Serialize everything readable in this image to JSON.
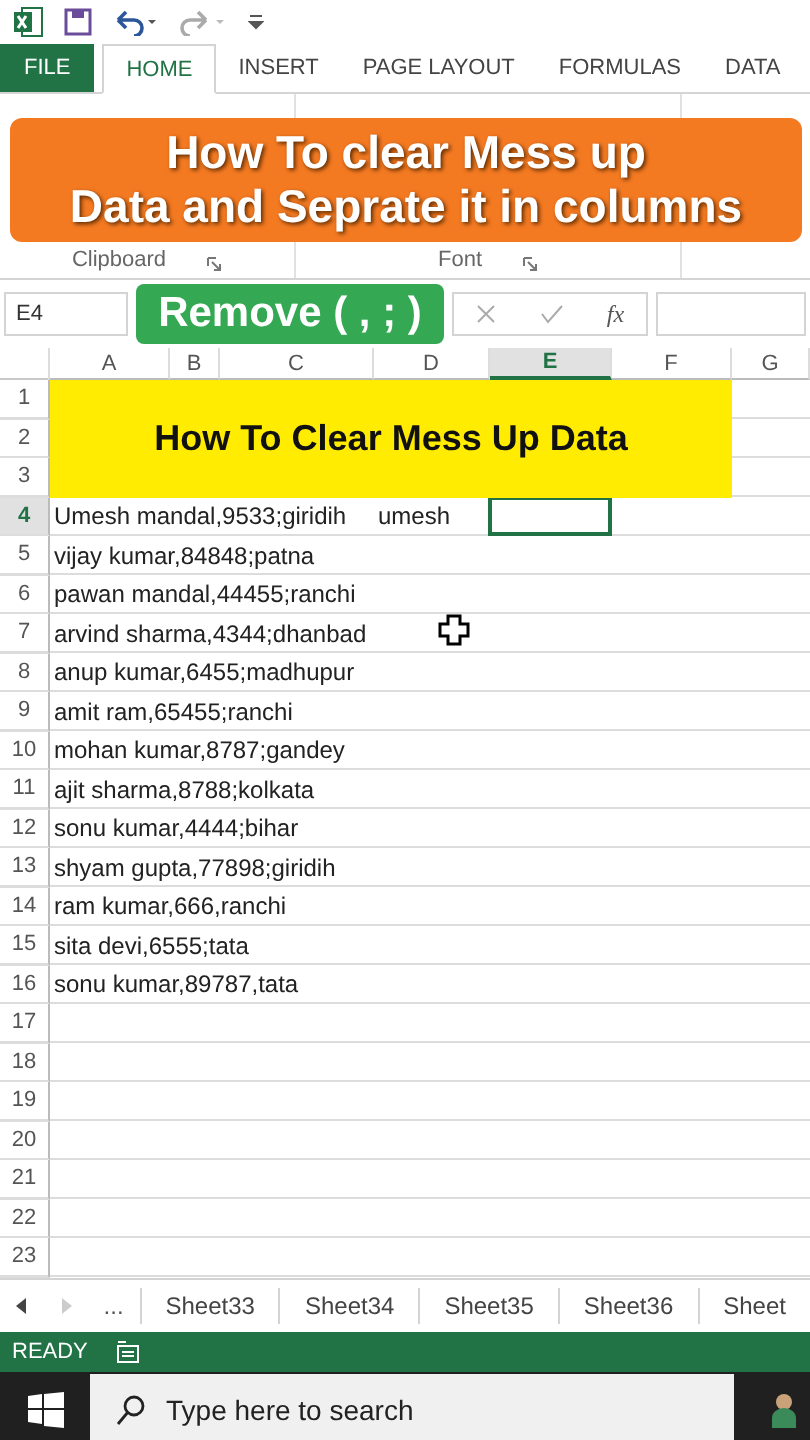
{
  "ribbon_tabs": [
    {
      "label": "FILE",
      "kind": "file",
      "selected": false
    },
    {
      "label": "HOME",
      "kind": "tab",
      "selected": true
    },
    {
      "label": "INSERT",
      "kind": "tab",
      "selected": false
    },
    {
      "label": "PAGE LAYOUT",
      "kind": "tab",
      "selected": false
    },
    {
      "label": "FORMULAS",
      "kind": "tab",
      "selected": false
    },
    {
      "label": "DATA",
      "kind": "tab",
      "selected": false
    }
  ],
  "ribbon_groups": [
    "Clipboard",
    "Font"
  ],
  "banner": {
    "lines": [
      "How To clear Mess up",
      "Data and Seprate it in columns"
    ]
  },
  "formula_bar": {
    "name_box": "E4",
    "overlay": "Remove ( , ; )",
    "fx": "fx"
  },
  "columns": [
    {
      "label": "A",
      "selected": false
    },
    {
      "label": "B",
      "selected": false
    },
    {
      "label": "C",
      "selected": false
    },
    {
      "label": "D",
      "selected": false
    },
    {
      "label": "E",
      "selected": true
    },
    {
      "label": "F",
      "selected": false
    },
    {
      "label": "G",
      "selected": false
    }
  ],
  "title_cell": {
    "text": "How To Clear Mess Up Data"
  },
  "rows": [
    {
      "number": "1",
      "selected": false
    },
    {
      "number": "2",
      "selected": false
    },
    {
      "number": "3",
      "selected": false
    },
    {
      "number": "4",
      "selected": true,
      "cells": {
        "A": "Umesh mandal,9533;giridih",
        "D": "umesh"
      }
    },
    {
      "number": "5",
      "selected": false,
      "cells": {
        "A": "vijay kumar,84848;patna"
      }
    },
    {
      "number": "6",
      "selected": false,
      "cells": {
        "A": "pawan mandal,44455;ranchi"
      }
    },
    {
      "number": "7",
      "selected": false,
      "cells": {
        "A": "arvind sharma,4344;dhanbad"
      }
    },
    {
      "number": "8",
      "selected": false,
      "cells": {
        "A": "anup kumar,6455;madhupur"
      }
    },
    {
      "number": "9",
      "selected": false,
      "cells": {
        "A": "amit ram,65455;ranchi"
      }
    },
    {
      "number": "10",
      "selected": false,
      "cells": {
        "A": "mohan kumar,8787;gandey"
      }
    },
    {
      "number": "11",
      "selected": false,
      "cells": {
        "A": "ajit sharma,8788;kolkata"
      }
    },
    {
      "number": "12",
      "selected": false,
      "cells": {
        "A": "sonu kumar,4444;bihar"
      }
    },
    {
      "number": "13",
      "selected": false,
      "cells": {
        "A": "shyam gupta,77898;giridih"
      }
    },
    {
      "number": "14",
      "selected": false,
      "cells": {
        "A": "ram kumar,666,ranchi"
      }
    },
    {
      "number": "15",
      "selected": false,
      "cells": {
        "A": "sita devi,6555;tata"
      }
    },
    {
      "number": "16",
      "selected": false,
      "cells": {
        "A": "sonu kumar,89787,tata"
      }
    },
    {
      "number": "17",
      "selected": false
    },
    {
      "number": "18",
      "selected": false
    },
    {
      "number": "19",
      "selected": false
    },
    {
      "number": "20",
      "selected": false
    },
    {
      "number": "21",
      "selected": false
    },
    {
      "number": "22",
      "selected": false
    },
    {
      "number": "23",
      "selected": false
    }
  ],
  "sheet_tabs": {
    "more": "...",
    "sheets": [
      "Sheet33",
      "Sheet34",
      "Sheet35",
      "Sheet36",
      "Sheet"
    ]
  },
  "status_bar": {
    "text": "READY"
  },
  "taskbar": {
    "search": {
      "placeholder": "Type here to search"
    }
  }
}
